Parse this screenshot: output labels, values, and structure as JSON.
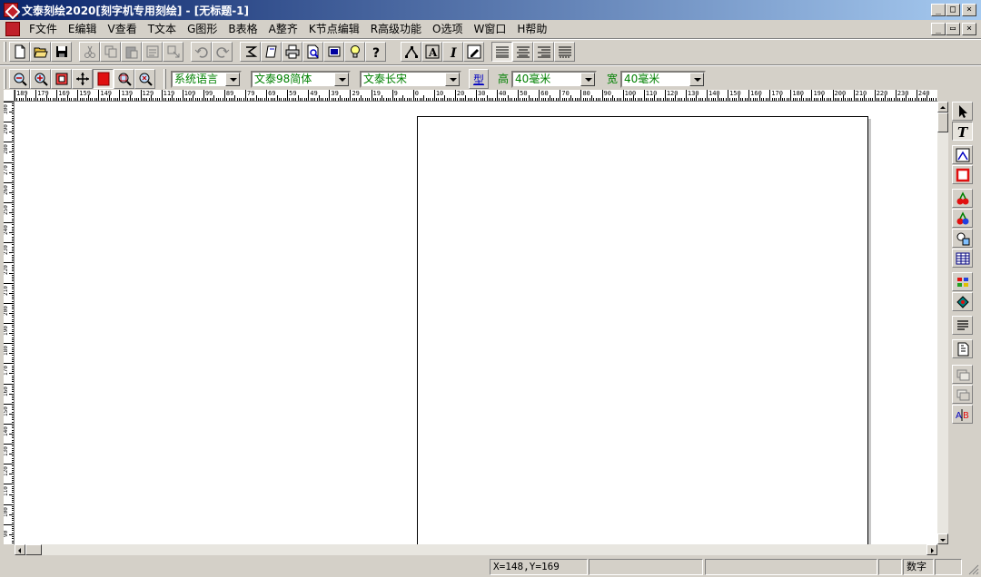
{
  "window": {
    "title": "文泰刻绘2020[刻字机专用刻绘] - [无标题-1]",
    "caption_buttons": [
      "_",
      "□",
      "×"
    ],
    "mdi_buttons": [
      "_",
      "▭",
      "×"
    ]
  },
  "menu": {
    "items": [
      "F文件",
      "E编辑",
      "V查看",
      "T文本",
      "G图形",
      "B表格",
      "A整齐",
      "K节点编辑",
      "R高级功能",
      "O选项",
      "W窗口",
      "H帮助"
    ]
  },
  "toolbar_main": {
    "buttons": [
      "new-file",
      "open",
      "save",
      "cut",
      "copy",
      "paste",
      "paste-special",
      "clone",
      "undo",
      "redo",
      "import",
      "open-doc",
      "print",
      "print-preview",
      "output",
      "tip",
      "help",
      "node-edit",
      "text-box",
      "italic",
      "edit-text",
      "align-left",
      "align-center",
      "align-right",
      "justify"
    ]
  },
  "toolbar_format": {
    "zoom_buttons": [
      "zoom-out",
      "zoom-in",
      "zoom-page",
      "pan",
      "color-red",
      "zoom-fit",
      "zoom-select"
    ],
    "language": "系统语言",
    "font": "文泰98简体",
    "style": "文泰长宋",
    "type_label": "型",
    "height_label": "高",
    "height_value": "40毫米",
    "width_label": "宽",
    "width_value": "40毫米"
  },
  "rulers": {
    "top_labels": [
      "189",
      "179",
      "169",
      "159",
      "149",
      "139",
      "129",
      "119",
      "109",
      "99",
      "89",
      "79",
      "69",
      "59",
      "49",
      "39",
      "29",
      "19",
      "9",
      "0",
      "10",
      "20",
      "30",
      "40",
      "50",
      "60",
      "70",
      "80",
      "90",
      "100",
      "110",
      "120",
      "130",
      "140",
      "150",
      "160",
      "170",
      "180",
      "190",
      "200",
      "210",
      "220",
      "230",
      "240"
    ],
    "left_labels": [
      "300",
      "290",
      "280",
      "270",
      "260",
      "250",
      "240",
      "230",
      "220",
      "210",
      "200",
      "190",
      "180",
      "170",
      "160",
      "150",
      "140",
      "130",
      "120",
      "110",
      "100",
      "90"
    ]
  },
  "status": {
    "coordinates": "X=148,Y=169",
    "mode": "数字"
  },
  "colors": {
    "title_start": "#0a246a",
    "title_end": "#a6caf0",
    "accent_red": "#e01010",
    "combo_text": "#008000"
  }
}
